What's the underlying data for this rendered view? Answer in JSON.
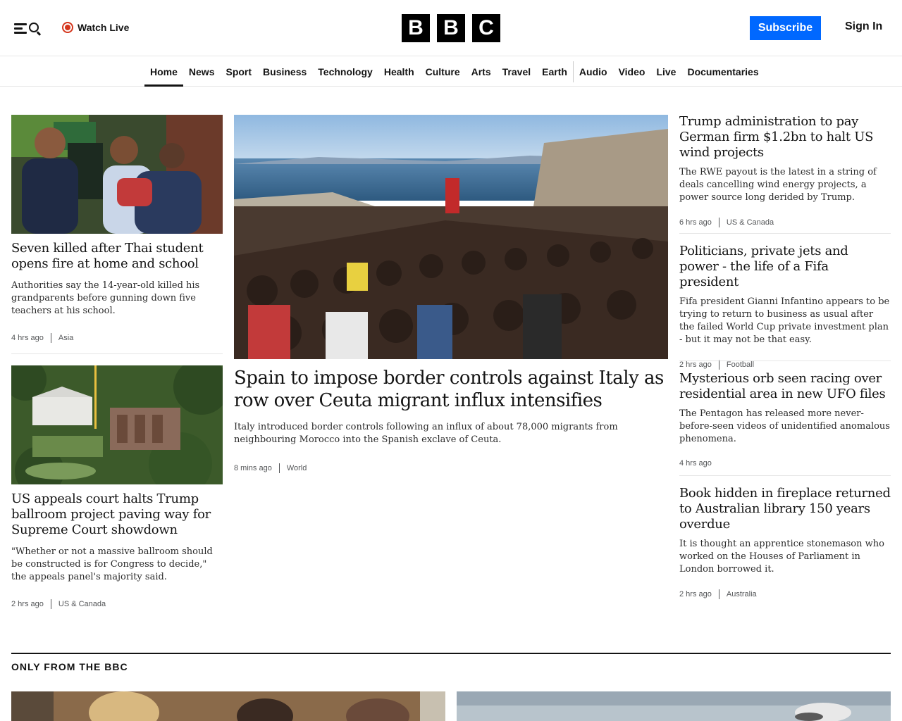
{
  "header": {
    "watch_live": "Watch Live",
    "logo": [
      "B",
      "B",
      "C"
    ],
    "subscribe": "Subscribe",
    "sign_in": "Sign In"
  },
  "nav": {
    "items": [
      "Home",
      "News",
      "Sport",
      "Business",
      "Technology",
      "Health",
      "Culture",
      "Arts",
      "Travel",
      "Earth",
      "Audio",
      "Video",
      "Live",
      "Documentaries"
    ],
    "active": "Home"
  },
  "stories": {
    "left1": {
      "headline": "Seven killed after Thai student opens fire at home and school",
      "summary": "Authorities say the 14-year-old killed his grandparents before gunning down five teachers at his school.",
      "time": "4 hrs ago",
      "section": "Asia"
    },
    "left2": {
      "headline": "US appeals court halts Trump ballroom project paving way for Supreme Court showdown",
      "summary": "\"Whether or not a massive ballroom should be constructed is for Congress to decide,\" the appeals panel's majority said.",
      "time": "2 hrs ago",
      "section": "US & Canada"
    },
    "main": {
      "headline": "Spain to impose border controls against Italy as row over Ceuta migrant influx intensifies",
      "summary": "Italy introduced border controls following an influx of about 78,000 migrants from neighbouring Morocco into the Spanish exclave of Ceuta.",
      "time": "8 mins ago",
      "section": "World"
    },
    "right": [
      {
        "headline": "Trump administration to pay German firm $1.2bn to halt US wind projects",
        "summary": "The RWE payout is the latest in a string of deals cancelling wind energy projects, a power source long derided by Trump.",
        "time": "6 hrs ago",
        "section": "US & Canada"
      },
      {
        "headline": "Politicians, private jets and power - the life of a Fifa president",
        "summary": "Fifa president Gianni Infantino appears to be trying to return to business as usual after the failed World Cup private investment plan - but it may not be that easy.",
        "time": "2 hrs ago",
        "section": "Football"
      },
      {
        "headline": "Mysterious orb seen racing over residential area in new UFO files",
        "summary": "The Pentagon has released more never-before-seen videos of unidentified anomalous phenomena.",
        "time": "4 hrs ago",
        "section": ""
      },
      {
        "headline": "Book hidden in fireplace returned to Australian library 150 years overdue",
        "summary": "It is thought an apprentice stonemason who worked on the Houses of Parliament in London borrowed it.",
        "time": "2 hrs ago",
        "section": "Australia"
      }
    ]
  },
  "only_from_bbc": {
    "title": "ONLY FROM THE BBC"
  },
  "colors": {
    "accent": "#0068ff",
    "live": "#d4351c",
    "text": "#141414"
  }
}
